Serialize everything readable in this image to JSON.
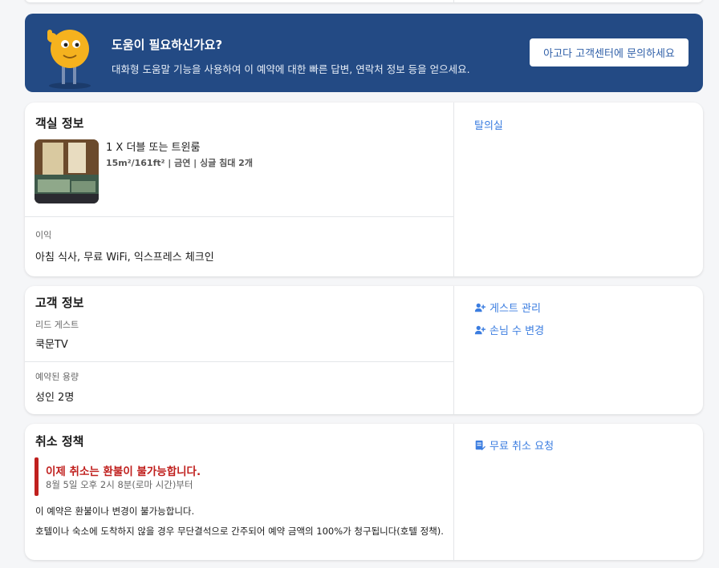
{
  "help": {
    "title": "도움이 필요하신가요?",
    "description": "대화형 도움말 기능을 사용하여 이 예약에 대한 빠른 답변, 연락처 정보 등을 얻으세요.",
    "button": "아고다 고객센터에 문의하세요"
  },
  "room": {
    "section_title": "객실 정보",
    "room_name": "1 X 더블 또는 트윈룸",
    "room_details": "15m²/161ft² | 금연 | 싱글 침대 2개",
    "benefits_label": "이익",
    "benefits_value": "아침 식사, 무료 WiFi, 익스프레스 체크인",
    "side_link": "탈의실"
  },
  "guest": {
    "section_title": "고객 정보",
    "lead_label": "리드 게스트",
    "lead_value": "쿡문TV",
    "capacity_label": "예약된 용량",
    "capacity_value": "성인 2명",
    "manage_link": "게스트 관리",
    "change_link": "손님 수 변경"
  },
  "cancel": {
    "section_title": "취소 정책",
    "alert_title": "이제 취소는 환불이 불가능합니다.",
    "alert_sub": "8월 5일 오후 2시 8분(로마 시간)부터",
    "line1": "이 예약은 환불이나 변경이 불가능합니다.",
    "line2": "호텔이나 숙소에 도착하지 않을 경우 무단결석으로 간주되어 예약 금액의 100%가 청구됩니다(호텔 정책).",
    "side_link": "무료 취소 요청"
  },
  "colors": {
    "banner": "#234a84",
    "link": "#3b7de0",
    "alert": "#c0201e"
  }
}
